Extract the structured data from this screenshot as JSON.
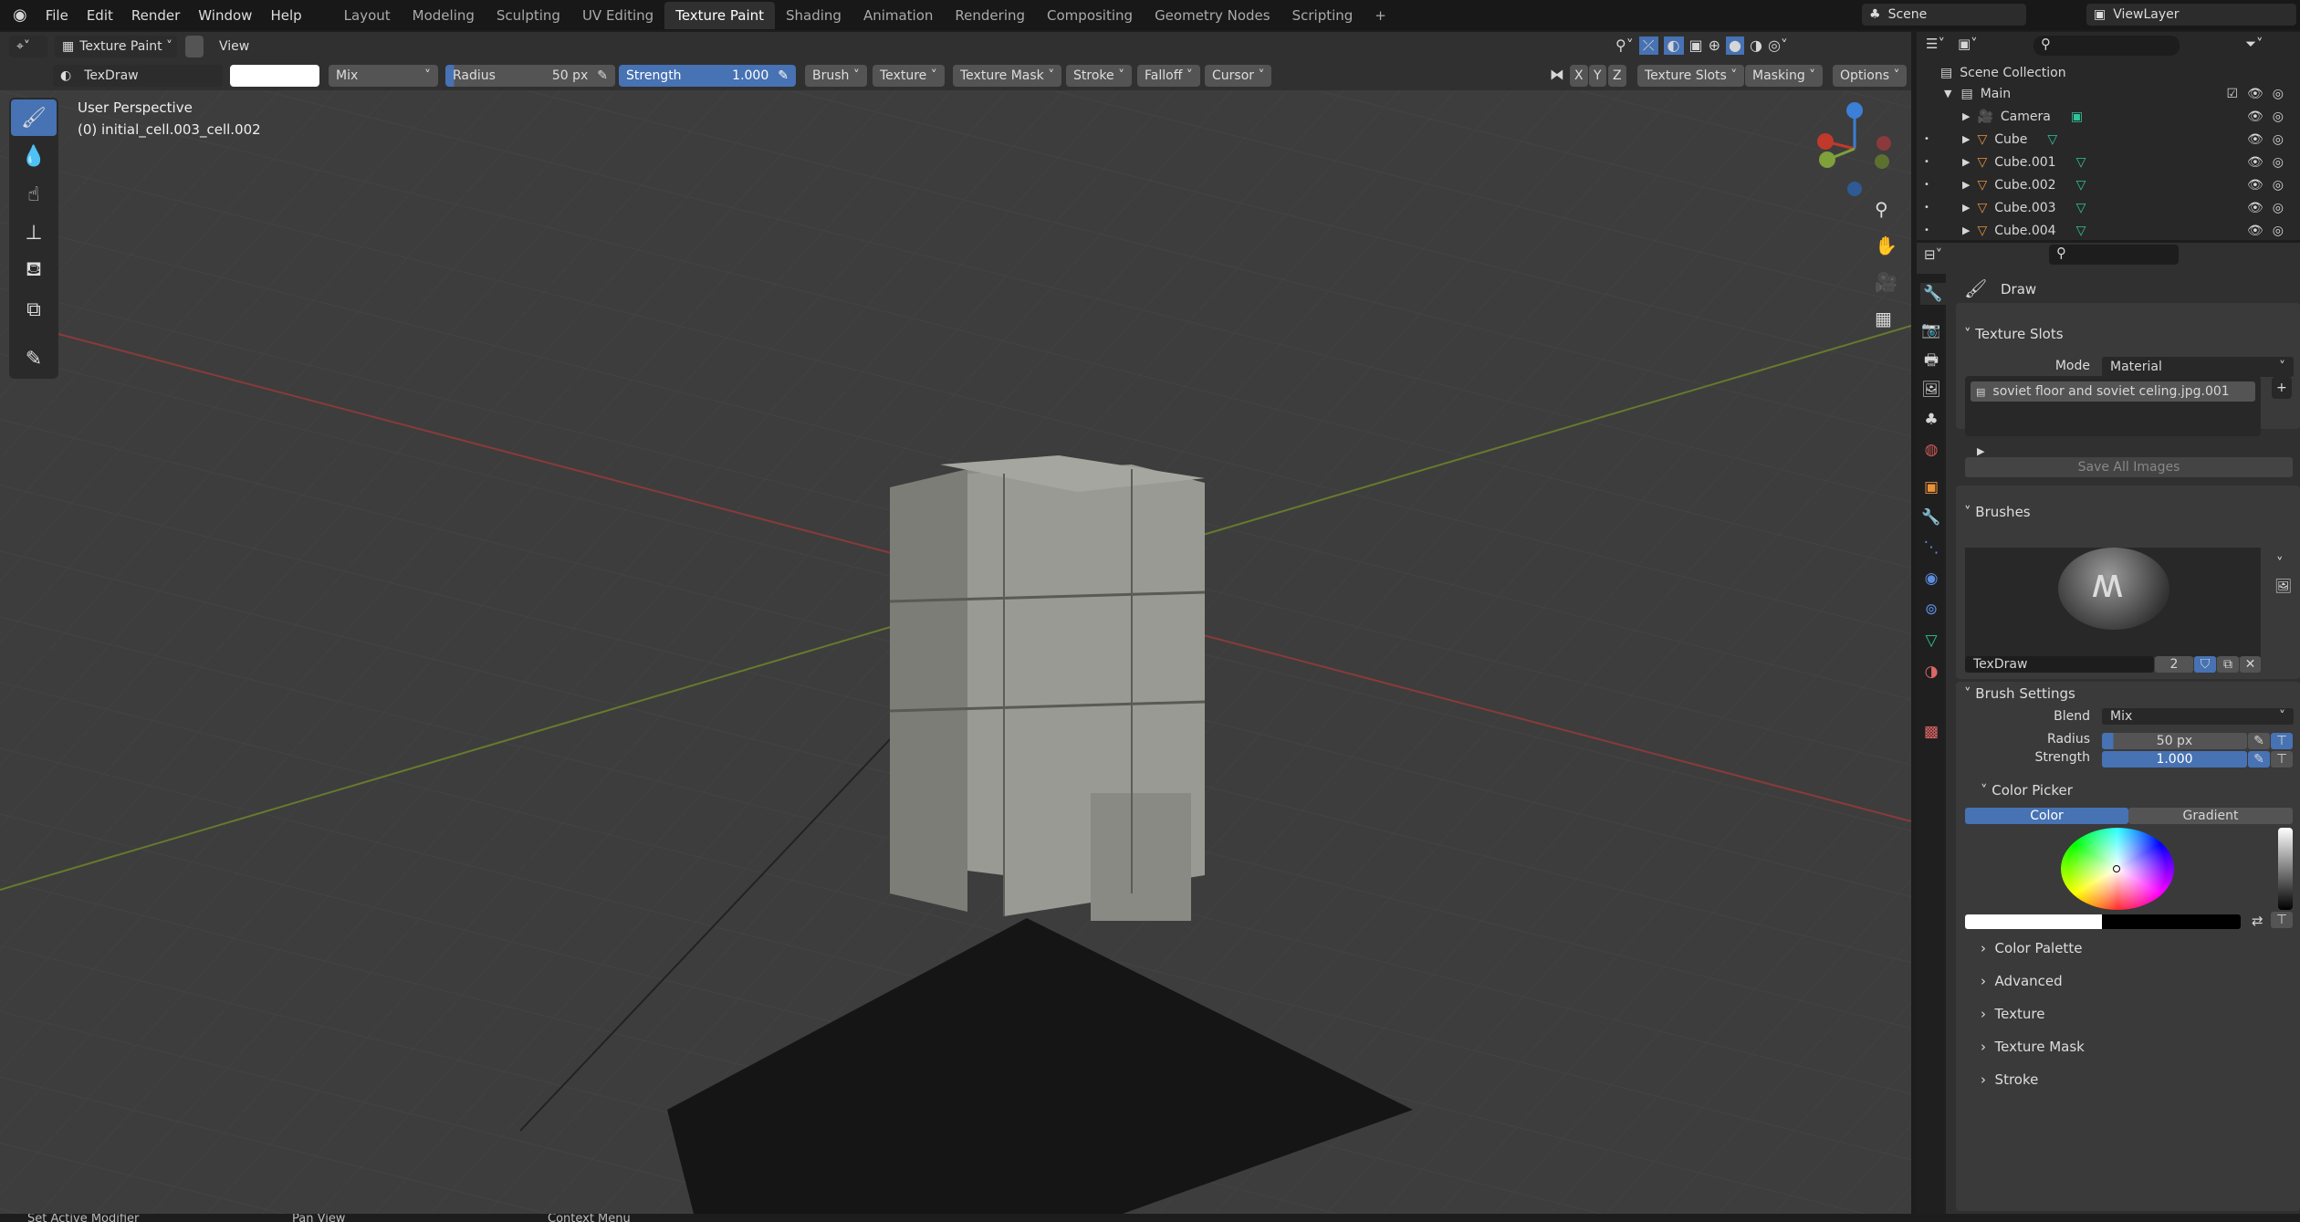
{
  "menu": [
    "File",
    "Edit",
    "Render",
    "Window",
    "Help"
  ],
  "workspaces": [
    "Layout",
    "Modeling",
    "Sculpting",
    "UV Editing",
    "Texture Paint",
    "Shading",
    "Animation",
    "Rendering",
    "Compositing",
    "Geometry Nodes",
    "Scripting",
    "+"
  ],
  "active_workspace": "Texture Paint",
  "scene": {
    "label": "Scene",
    "view_layer": "ViewLayer"
  },
  "header": {
    "mode": "Texture Paint",
    "view": "View"
  },
  "toolsettings": {
    "brush": "TexDraw",
    "blend": "Mix",
    "radius_label": "Radius",
    "radius": "50 px",
    "strength_label": "Strength",
    "strength": "1.000",
    "menus": [
      "Brush",
      "Texture",
      "Texture Mask",
      "Stroke",
      "Falloff",
      "Cursor"
    ],
    "axes": [
      "X",
      "Y",
      "Z"
    ],
    "right_menus": [
      "Texture Slots",
      "Masking",
      "Options"
    ]
  },
  "viewport": {
    "perspective": "User Perspective",
    "object": "(0) initial_cell.003_cell.002",
    "axis_colors": {
      "x": "#c0392b",
      "y": "#7fa03a",
      "z": "#3c7fd6"
    }
  },
  "outliner": {
    "root": "Scene Collection",
    "collection": "Main",
    "items": [
      "Camera",
      "Cube",
      "Cube.001",
      "Cube.002",
      "Cube.003",
      "Cube.004"
    ]
  },
  "properties": {
    "tool_name": "Draw",
    "texture_slots": {
      "title": "Texture Slots",
      "mode_label": "Mode",
      "mode": "Material",
      "slot": "soviet floor and soviet celing.jpg.001",
      "save": "Save All Images"
    },
    "brushes": {
      "title": "Brushes",
      "name": "TexDraw",
      "users": "2"
    },
    "brush_settings": {
      "title": "Brush Settings",
      "blend_label": "Blend",
      "blend": "Mix",
      "radius_label": "Radius",
      "radius": "50 px",
      "strength_label": "Strength",
      "strength": "1.000",
      "strength_fraction": 1.0
    },
    "color_picker": {
      "title": "Color Picker",
      "tabs": [
        "Color",
        "Gradient"
      ],
      "active_tab": "Color",
      "primary": "#ffffff",
      "secondary": "#000000"
    },
    "subpanels": [
      "Color Palette",
      "Advanced",
      "Texture",
      "Texture Mask",
      "Stroke"
    ]
  },
  "status": [
    "Set Active Modifier",
    "Pan View",
    "Context Menu"
  ],
  "accent": "#4772b3"
}
